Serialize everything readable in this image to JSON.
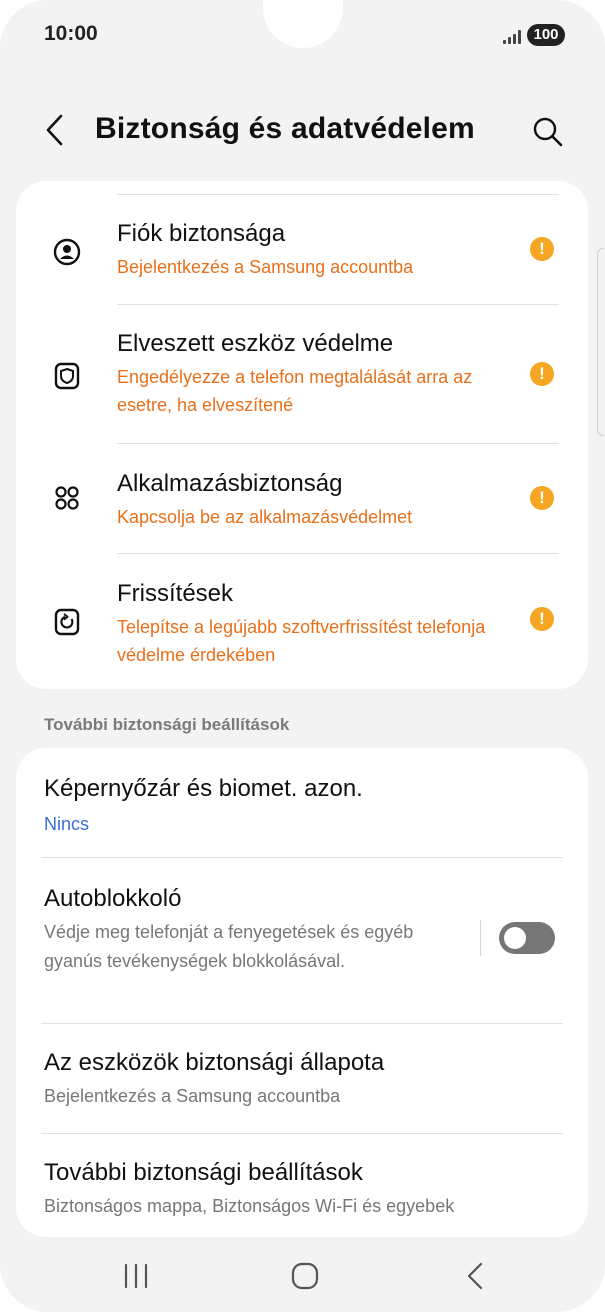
{
  "status_bar": {
    "time": "10:00",
    "battery": "100"
  },
  "header": {
    "title": "Biztonság és adatvédelem",
    "back_icon": "chevron-left-icon",
    "search_icon": "search-icon"
  },
  "top_items": [
    {
      "title": "Fiók biztonsága",
      "subtitle": "Bejelentkezés a Samsung accountba",
      "icon": "account-icon",
      "warning": "!"
    },
    {
      "title": "Elveszett eszköz védelme",
      "subtitle": "Engedélyezze a telefon megtalálását arra az esetre, ha elveszítené",
      "icon": "shield-icon",
      "warning": "!"
    },
    {
      "title": "Alkalmazásbiztonság",
      "subtitle": "Kapcsolja be az alkalmazásvédelmet",
      "icon": "apps-icon",
      "warning": "!"
    },
    {
      "title": "Frissítések",
      "subtitle": "Telepítse a legújabb szoftverfrissítést telefonja védelme érdekében",
      "icon": "update-icon",
      "warning": "!"
    }
  ],
  "section_header": "További biztonsági beállítások",
  "bottom_items": [
    {
      "title": "Képernyőzár és biomet. azon.",
      "subtitle": "Nincs"
    },
    {
      "title": "Autoblokkoló",
      "subtitle": "Védje meg telefonját a fenyegetések és egyéb gyanús tevékenységek blokkolásával.",
      "toggle_on": false
    },
    {
      "title": "Az eszközök biztonsági állapota",
      "subtitle": "Bejelentkezés a Samsung accountba"
    },
    {
      "title": "További biztonsági beállítások",
      "subtitle": "Biztonságos mappa, Biztonságos Wi-Fi és egyebek"
    }
  ],
  "nav_bar": {
    "recents_icon": "recents-icon",
    "home_icon": "home-icon",
    "back_icon": "back-icon"
  },
  "colors": {
    "warning": "#e8701a",
    "badge": "#f5a623",
    "link_blue": "#3a6fd8",
    "background": "#f3f3f3"
  }
}
